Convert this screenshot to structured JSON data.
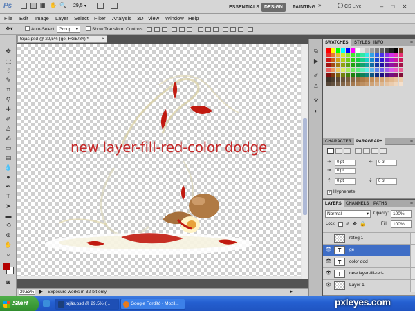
{
  "titlebar": {
    "app_logo": "Ps",
    "zoom_value": "29,5",
    "workspaces": [
      "ESSENTIALS",
      "DESIGN",
      "PAINTING"
    ],
    "active_workspace": "DESIGN",
    "more_chevron": "»",
    "cs_live": "CS Live",
    "window_controls": [
      "–",
      "□",
      "✕"
    ]
  },
  "menubar": {
    "items": [
      "File",
      "Edit",
      "Image",
      "Layer",
      "Select",
      "Filter",
      "Analysis",
      "3D",
      "View",
      "Window",
      "Help"
    ]
  },
  "options_bar": {
    "auto_select_label": "Auto-Select:",
    "auto_select_value": "Group",
    "show_transform_label": "Show Transform Controls"
  },
  "document": {
    "tab_title": "tojás.psd @ 29,5% (ge, RGB/8#) *",
    "tab_close": "×",
    "canvas_text": "new layer-fill-red-color dodge",
    "zoom": "29.53%",
    "status_message": "Exposure works in 32-bit only"
  },
  "swatches_panel": {
    "tabs": [
      "SWATCHES",
      "STYLES",
      "INFO"
    ],
    "active_tab": "SWATCHES"
  },
  "character_panel": {
    "tabs": [
      "CHARACTER",
      "PARAGRAPH"
    ],
    "active_tab": "PARAGRAPH",
    "indent_left": "0 pt",
    "indent_right": "0 pt",
    "indent_first": "0 pt",
    "space_before": "0 pt",
    "space_after": "0 pt",
    "hyphenate_label": "Hyphenate"
  },
  "layers_panel": {
    "tabs": [
      "LAYERS",
      "CHANNELS",
      "PATHS"
    ],
    "active_tab": "LAYERS",
    "blend_mode": "Normal",
    "opacity_label": "Opacity:",
    "opacity_value": "100%",
    "lock_label": "Lock:",
    "fill_label": "Fill:",
    "fill_value": "100%",
    "layers": [
      {
        "name": "réteg 1",
        "type": "raster",
        "visible": false,
        "selected": false
      },
      {
        "name": "ge",
        "type": "text",
        "visible": true,
        "selected": true
      },
      {
        "name": "color dod",
        "type": "text",
        "visible": true,
        "selected": false
      },
      {
        "name": "new layer-fill-red-",
        "type": "text",
        "visible": true,
        "selected": false
      },
      {
        "name": "Layer 1",
        "type": "raster",
        "visible": true,
        "selected": false
      }
    ],
    "text_thumb": "T"
  },
  "taskbar": {
    "start_label": "Start",
    "items": [
      {
        "label": "tojás.psd @ 29,5% (...",
        "active": true
      },
      {
        "label": "Google Fordító - Mozil...",
        "active": false
      }
    ]
  },
  "watermark": "pxleyes.com",
  "colors": {
    "foreground": "#b40000",
    "background": "#ffffff",
    "canvas_text": "#c52a2a",
    "selection": "#3f6ec6"
  }
}
